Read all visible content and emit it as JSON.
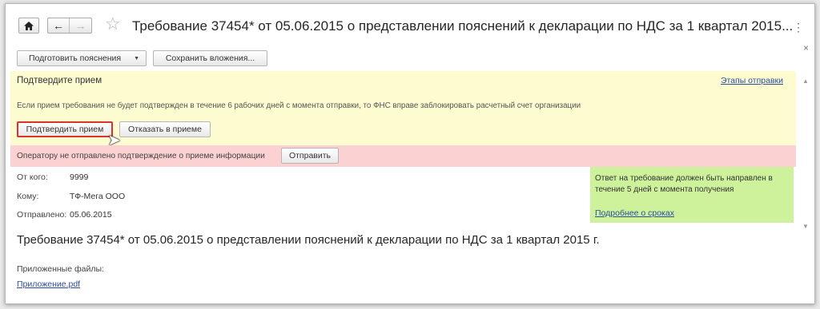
{
  "window": {
    "title": "Требование 37454* от 05.06.2015 о представлении пояснений к декларации по НДС за 1 квартал 2015...",
    "more_icon": "⋮",
    "close_icon": "×"
  },
  "nav": {
    "home_icon": "home-icon",
    "back_arrow": "←",
    "forward_arrow": "→",
    "star": "☆"
  },
  "toolbar": {
    "prepare_label": "Подготовить пояснения",
    "save_attachments_label": "Сохранить вложения..."
  },
  "confirm_panel": {
    "title": "Подтвердите прием",
    "stages_link": "Этапы отправки",
    "warning": "Если прием требования не будет подтвержден в течение 6 рабочих дней с момента отправки, то ФНС вправе заблокировать расчетный счет организации",
    "confirm_label": "Подтвердить прием",
    "reject_label": "Отказать в приеме",
    "color": "#fdfcd1"
  },
  "operator_panel": {
    "text": "Оператору не отправлено подтверждение о приеме информации",
    "send_label": "Отправить",
    "color": "#fbd1d1"
  },
  "details": {
    "from_label": "От кого:",
    "from_value": "9999",
    "to_label": "Кому:",
    "to_value": "ТФ-Мега ООО",
    "sent_label": "Отправлено:",
    "sent_value": "05.06.2015"
  },
  "deadline_panel": {
    "text": "Ответ на требование должен быть направлен в течение 5 дней с момента получения",
    "link": "Подробнее о сроках",
    "color": "#cdf29b"
  },
  "document": {
    "heading": "Требование 37454* от 05.06.2015 о представлении пояснений к декларации по НДС за 1 квартал 2015 г.",
    "attached_label": "Приложенные файлы:",
    "file_name": "Приложение.pdf"
  }
}
